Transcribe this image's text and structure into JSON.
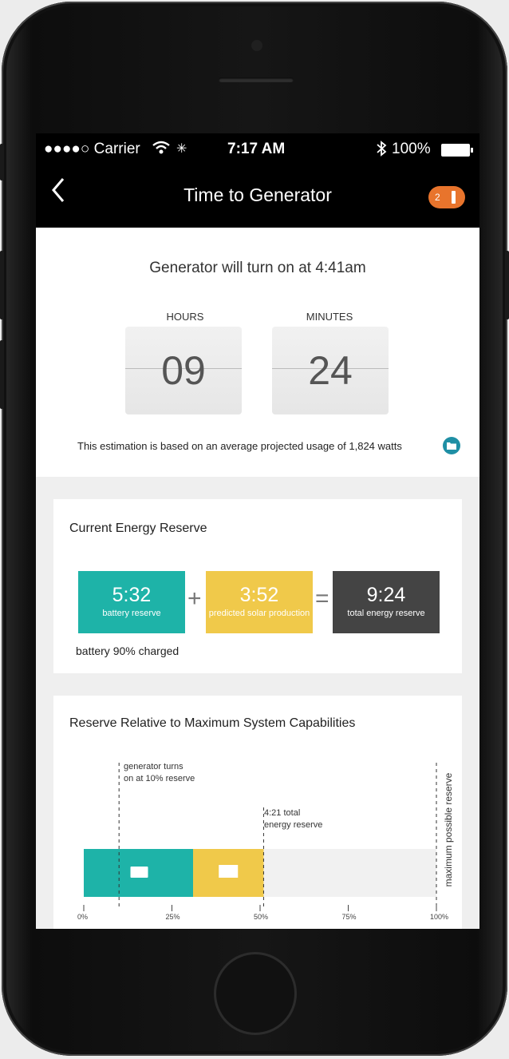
{
  "status": {
    "signal": "●●●●○ Carrier",
    "time": "7:17 AM",
    "battery": "100%"
  },
  "nav": {
    "back_icon": "chevron-left-icon",
    "title": "Time to Generator",
    "badge_count": "2",
    "badge_color": "#e8742c"
  },
  "countdown": {
    "headline": "Generator will turn on at 4:41am",
    "hours_label": "HOURS",
    "hours_value": "09",
    "minutes_label": "MINUTES",
    "minutes_value": "24",
    "note": "This estimation is based on an average projected usage of 1,824 watts"
  },
  "reserve": {
    "title": "Current Energy Reserve",
    "battery_value": "5:32",
    "battery_label": "battery reserve",
    "solar_value": "3:52",
    "solar_label": "predicted solar production",
    "total_value": "9:24",
    "total_label": "total energy reserve",
    "plus": "+",
    "equals": "=",
    "charged_note": "battery 90% charged",
    "colors": {
      "battery": "#1eb3a8",
      "solar": "#f0c94a",
      "total": "#444444"
    }
  },
  "relative": {
    "title": "Reserve Relative to Maximum System Capabilities",
    "generator_note_1": "generator turns",
    "generator_note_2": "on at 10% reserve",
    "total_note_1": "4:21 total",
    "total_note_2": "energy reserve",
    "max_label": "maximum possible reserve",
    "ticks": [
      "0%",
      "25%",
      "50%",
      "75%",
      "100%"
    ],
    "battery_pct": 31,
    "solar_pct": 20,
    "generator_pct": 10
  }
}
